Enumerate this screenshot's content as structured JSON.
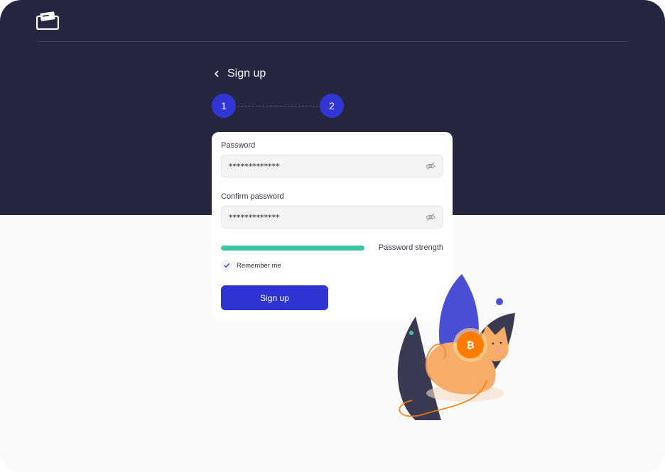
{
  "header": {
    "title": "Sign up"
  },
  "steps": [
    {
      "label": "1"
    },
    {
      "label": "2"
    }
  ],
  "form": {
    "password": {
      "label": "Password",
      "value": "*************"
    },
    "confirm_password": {
      "label": "Confirm password",
      "value": "*************"
    },
    "strength": {
      "label": "Password strength",
      "level": 1.0
    },
    "remember_me": {
      "label": "Remember me",
      "checked": true
    },
    "submit_label": "Sign up"
  },
  "icons": {
    "logo": "wallet-logo-icon",
    "back": "chevron-left-icon",
    "eye": "eye-off-icon",
    "check": "check-icon"
  },
  "colors": {
    "header_background": "#252640",
    "page_background": "#fafafa",
    "accent": "#2e33d1",
    "strength": "#3dc4a2",
    "coin": "#ff7a00"
  }
}
